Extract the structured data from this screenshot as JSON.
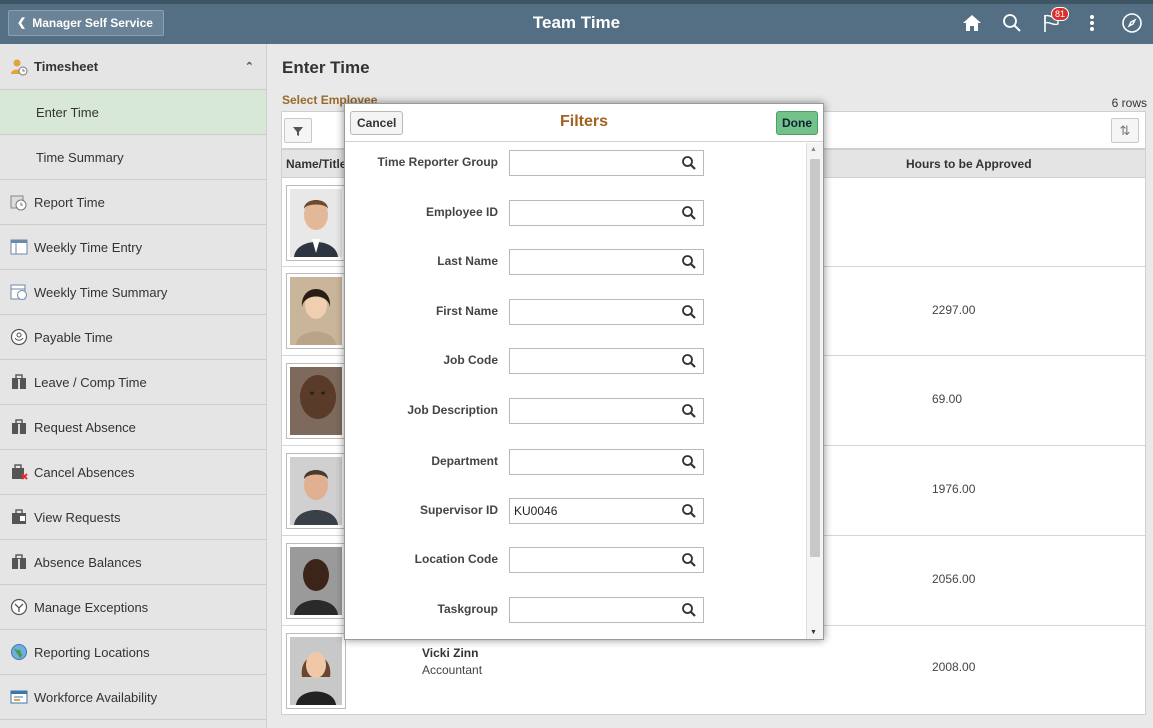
{
  "header": {
    "back_label": "Manager Self Service",
    "title": "Team Time",
    "notification_count": "81",
    "icons": [
      "home-icon",
      "search-icon",
      "flag-icon",
      "more-options-icon",
      "navbar-compass-icon"
    ]
  },
  "sidebar": {
    "section_label": "Timesheet",
    "items": [
      {
        "label": "Enter Time",
        "active": true
      },
      {
        "label": "Time Summary"
      },
      {
        "label": "Report Time",
        "icon": "clock-icon"
      },
      {
        "label": "Weekly Time Entry",
        "icon": "calendar-grid-icon"
      },
      {
        "label": "Weekly Time Summary",
        "icon": "calendar-clock-icon"
      },
      {
        "label": "Payable Time",
        "icon": "payable-clock-icon"
      },
      {
        "label": "Leave / Comp Time",
        "icon": "briefcase-icon"
      },
      {
        "label": "Request Absence",
        "icon": "briefcase-icon"
      },
      {
        "label": "Cancel Absences",
        "icon": "briefcase-cancel-icon"
      },
      {
        "label": "View Requests",
        "icon": "briefcase-view-icon"
      },
      {
        "label": "Absence Balances",
        "icon": "briefcase-balance-icon"
      },
      {
        "label": "Manage Exceptions",
        "icon": "exception-icon"
      },
      {
        "label": "Reporting Locations",
        "icon": "globe-icon"
      },
      {
        "label": "Workforce Availability",
        "icon": "availability-icon"
      }
    ]
  },
  "main": {
    "title": "Enter Time",
    "select_label": "Select Employee",
    "rows_count": "6 rows",
    "columns": {
      "name": "Name/Title",
      "hours": "Hours to be Approved"
    },
    "rows": [
      {
        "name": "",
        "title": "",
        "hours": ""
      },
      {
        "name": "",
        "title": "",
        "hours": "2297.00"
      },
      {
        "name": "",
        "title": "",
        "hours": "69.00"
      },
      {
        "name": "",
        "title": "",
        "hours": "1976.00"
      },
      {
        "name": "",
        "title": "",
        "hours": "2056.00"
      },
      {
        "name": "Vicki Zinn",
        "title": "Accountant",
        "hours": "2008.00"
      }
    ]
  },
  "filters": {
    "title": "Filters",
    "cancel_label": "Cancel",
    "done_label": "Done",
    "fields": [
      {
        "label": "Time Reporter Group",
        "value": ""
      },
      {
        "label": "Employee ID",
        "value": ""
      },
      {
        "label": "Last Name",
        "value": ""
      },
      {
        "label": "First Name",
        "value": ""
      },
      {
        "label": "Job Code",
        "value": ""
      },
      {
        "label": "Job Description",
        "value": ""
      },
      {
        "label": "Department",
        "value": ""
      },
      {
        "label": "Supervisor ID",
        "value": "KU0046"
      },
      {
        "label": "Location Code",
        "value": ""
      },
      {
        "label": "Taskgroup",
        "value": ""
      }
    ]
  },
  "colors": {
    "header_bg": "#546f83",
    "active_item_bg": "#d8e8d8",
    "modal_title": "#a0621e",
    "done_button": "#72c28a"
  }
}
